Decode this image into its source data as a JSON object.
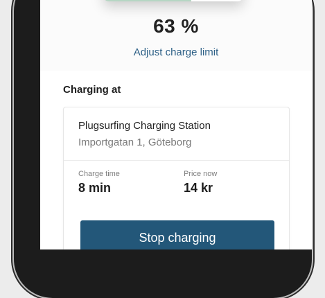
{
  "battery": {
    "level_fraction": 0.63,
    "fill_color": "#b6d6c3",
    "icon": "lightning-bolt-icon"
  },
  "charge": {
    "percent_text": "63 %",
    "adjust_link": "Adjust charge limit"
  },
  "charging_at": {
    "title": "Charging at",
    "station_name": "Plugsurfing Charging Station",
    "address": "Importgatan 1, Göteborg",
    "stats": [
      {
        "label": "Charge time",
        "value": "8 min"
      },
      {
        "label": "Price now",
        "value": "14 kr"
      }
    ],
    "stop_button": "Stop charging"
  },
  "colors": {
    "link": "#2c5f86",
    "button": "#235779"
  }
}
